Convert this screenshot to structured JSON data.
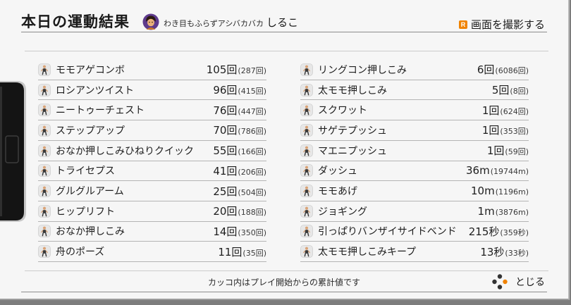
{
  "header": {
    "title": "本日の運動結果",
    "player_title": "わき目もふらずアシバカバカ",
    "player_name": "しるこ",
    "capture": {
      "button_glyph": "R",
      "label": "画面を撮影する"
    }
  },
  "results": {
    "left": [
      {
        "name": "モモアゲコンボ",
        "today": "105回",
        "total": "(287回)"
      },
      {
        "name": "ロシアンツイスト",
        "today": "96回",
        "total": "(415回)"
      },
      {
        "name": "ニートゥーチェスト",
        "today": "76回",
        "total": "(447回)"
      },
      {
        "name": "ステップアップ",
        "today": "70回",
        "total": "(786回)"
      },
      {
        "name": "おなか押しこみひねりクイック",
        "today": "55回",
        "total": "(166回)"
      },
      {
        "name": "トライセプス",
        "today": "41回",
        "total": "(206回)"
      },
      {
        "name": "グルグルアーム",
        "today": "25回",
        "total": "(504回)"
      },
      {
        "name": "ヒップリフト",
        "today": "20回",
        "total": "(188回)"
      },
      {
        "name": "おなか押しこみ",
        "today": "14回",
        "total": "(350回)"
      },
      {
        "name": "舟のポーズ",
        "today": "11回",
        "total": "(35回)"
      }
    ],
    "right": [
      {
        "name": "リングコン押しこみ",
        "today": "6回",
        "total": "(6086回)"
      },
      {
        "name": "太モモ押しこみ",
        "today": "5回",
        "total": "(8回)"
      },
      {
        "name": "スクワット",
        "today": "1回",
        "total": "(624回)"
      },
      {
        "name": "サゲテプッシュ",
        "today": "1回",
        "total": "(353回)"
      },
      {
        "name": "マエニプッシュ",
        "today": "1回",
        "total": "(59回)"
      },
      {
        "name": "ダッシュ",
        "today": "36m",
        "total": "(19744m)"
      },
      {
        "name": "モモあげ",
        "today": "10m",
        "total": "(1196m)"
      },
      {
        "name": "ジョギング",
        "today": "1m",
        "total": "(3876m)"
      },
      {
        "name": "引っぱりバンザイサイドベンド",
        "today": "215秒",
        "total": "(359秒)"
      },
      {
        "name": "太モモ押しこみキープ",
        "today": "13秒",
        "total": "(33秒)"
      }
    ]
  },
  "footer": {
    "note": "カッコ内はプレイ開始からの累計値です",
    "close_label": "とじる"
  },
  "icons": {
    "avatar": "player-avatar-icon",
    "capture": "r-button-icon",
    "exercise": "exercise-figure-icon",
    "close": "face-buttons-icon"
  },
  "colors": {
    "accent": "#f08300",
    "text": "#1e1e1e",
    "background": "#f6f6f6",
    "separator": "#b4b4b4"
  }
}
